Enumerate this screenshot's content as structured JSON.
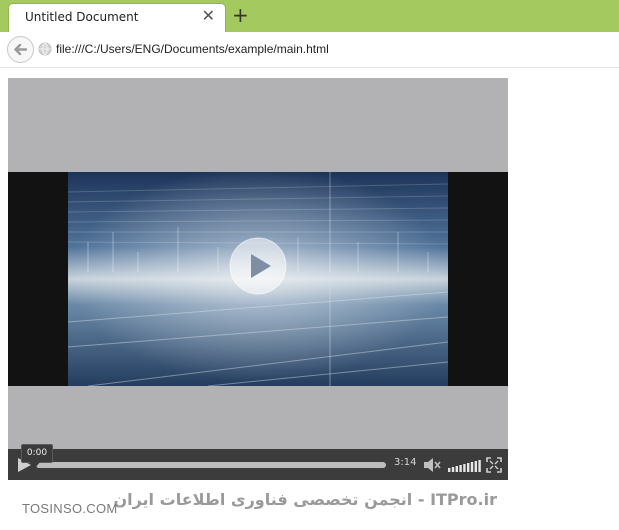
{
  "browser": {
    "tab_title": "Untitled Document",
    "tab_close_glyph": "✕",
    "new_tab_glyph": "+",
    "address": "file:///C:/Users/ENG/Documents/example/main.html",
    "accent_color": "#a3c95f"
  },
  "player": {
    "current_time": "0:00",
    "duration": "3:14",
    "progress": 0,
    "volume": 1.0,
    "icons": [
      "play-icon",
      "volume-icon",
      "fullscreen-icon",
      "big-play-icon"
    ]
  },
  "watermark": {
    "latin": "TOSINSO.COM",
    "rtl": "ITPro.ir - انجمن تخصصی فناوری اطلاعات ایران"
  }
}
